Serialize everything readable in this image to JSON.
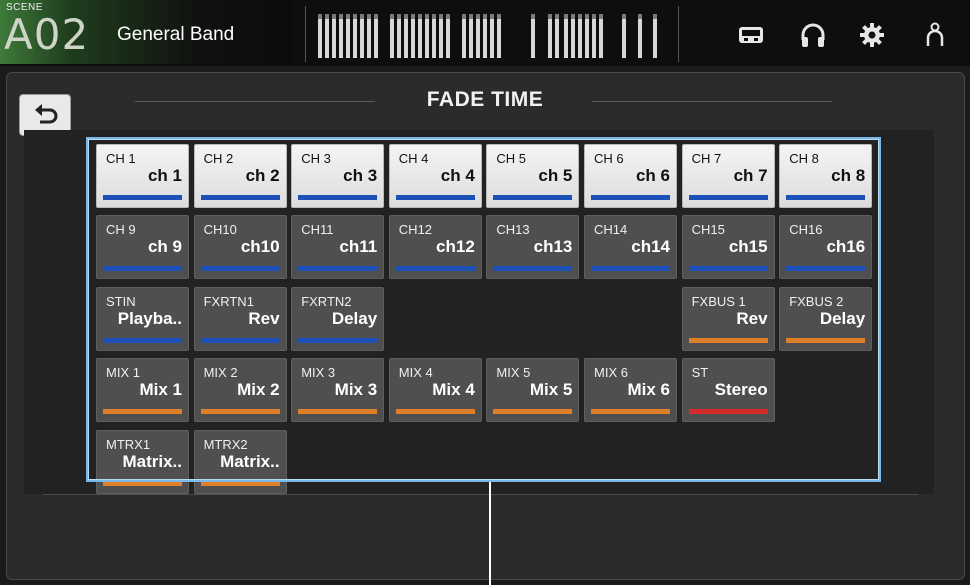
{
  "scene": {
    "label": "SCENE",
    "number": "A02",
    "name": "General Band"
  },
  "header": {
    "title": "FADE TIME"
  },
  "icons": [
    "back-arrow-icon",
    "recorder-icon",
    "headphones-icon",
    "gear-icon",
    "user-icon"
  ],
  "colors": {
    "blue": "#1d4fb8",
    "orange": "#e07f2a",
    "red": "#d62b2b",
    "selection": "#7ab8e8"
  },
  "channels": {
    "rows": [
      [
        {
          "top": "CH 1",
          "name": "ch 1",
          "color": "blue",
          "selected": true
        },
        {
          "top": "CH 2",
          "name": "ch 2",
          "color": "blue",
          "selected": true
        },
        {
          "top": "CH 3",
          "name": "ch 3",
          "color": "blue",
          "selected": true
        },
        {
          "top": "CH 4",
          "name": "ch 4",
          "color": "blue",
          "selected": true
        },
        {
          "top": "CH 5",
          "name": "ch 5",
          "color": "blue",
          "selected": true
        },
        {
          "top": "CH 6",
          "name": "ch 6",
          "color": "blue",
          "selected": true
        },
        {
          "top": "CH 7",
          "name": "ch 7",
          "color": "blue",
          "selected": true
        },
        {
          "top": "CH 8",
          "name": "ch 8",
          "color": "blue",
          "selected": true
        }
      ],
      [
        {
          "top": "CH 9",
          "name": "ch 9",
          "color": "blue",
          "selected": false
        },
        {
          "top": "CH10",
          "name": "ch10",
          "color": "blue",
          "selected": false
        },
        {
          "top": "CH11",
          "name": "ch11",
          "color": "blue",
          "selected": false
        },
        {
          "top": "CH12",
          "name": "ch12",
          "color": "blue",
          "selected": false
        },
        {
          "top": "CH13",
          "name": "ch13",
          "color": "blue",
          "selected": false
        },
        {
          "top": "CH14",
          "name": "ch14",
          "color": "blue",
          "selected": false
        },
        {
          "top": "CH15",
          "name": "ch15",
          "color": "blue",
          "selected": false
        },
        {
          "top": "CH16",
          "name": "ch16",
          "color": "blue",
          "selected": false
        }
      ],
      [
        {
          "top": "STIN",
          "name": "Playba..",
          "color": "blue",
          "selected": false
        },
        {
          "top": "FXRTN1",
          "name": "Rev",
          "color": "blue",
          "selected": false
        },
        {
          "top": "FXRTN2",
          "name": "Delay",
          "color": "blue",
          "selected": false
        },
        null,
        null,
        null,
        {
          "top": "FXBUS 1",
          "name": "Rev",
          "color": "orange",
          "selected": false
        },
        {
          "top": "FXBUS 2",
          "name": "Delay",
          "color": "orange",
          "selected": false
        }
      ],
      [
        {
          "top": "MIX 1",
          "name": "Mix 1",
          "color": "orange",
          "selected": false
        },
        {
          "top": "MIX 2",
          "name": "Mix 2",
          "color": "orange",
          "selected": false
        },
        {
          "top": "MIX 3",
          "name": "Mix 3",
          "color": "orange",
          "selected": false
        },
        {
          "top": "MIX 4",
          "name": "Mix 4",
          "color": "orange",
          "selected": false
        },
        {
          "top": "MIX 5",
          "name": "Mix 5",
          "color": "orange",
          "selected": false
        },
        {
          "top": "MIX 6",
          "name": "Mix 6",
          "color": "orange",
          "selected": false
        },
        {
          "top": "ST",
          "name": "Stereo",
          "color": "red",
          "selected": false
        },
        null
      ],
      [
        {
          "top": "MTRX1",
          "name": "Matrix..",
          "color": "orange",
          "selected": false
        },
        {
          "top": "MTRX2",
          "name": "Matrix..",
          "color": "orange",
          "selected": false
        },
        null,
        null,
        null,
        null,
        null,
        null
      ]
    ]
  }
}
